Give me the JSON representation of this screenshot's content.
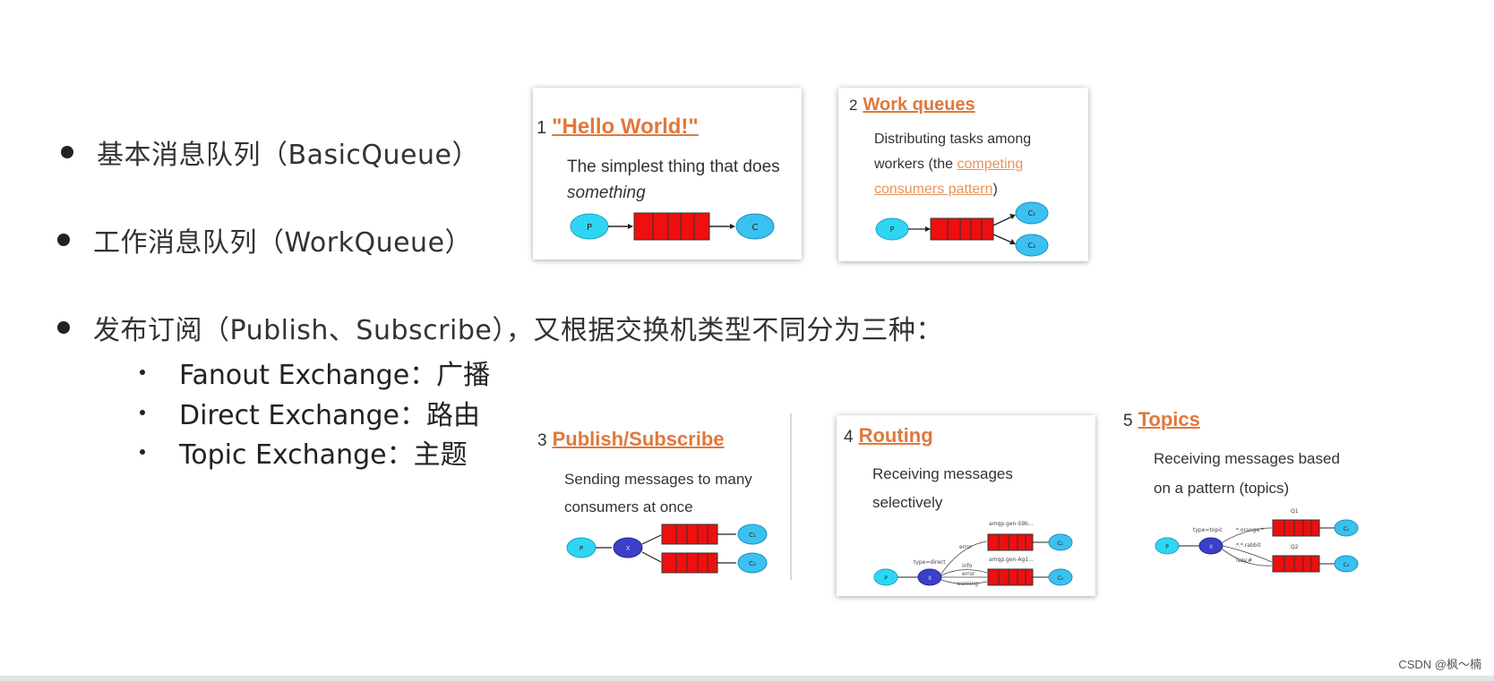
{
  "bullets": {
    "basic": "基本消息队列（BasicQueue）",
    "work": "工作消息队列（WorkQueue）",
    "pubsub": "发布订阅（Publish、Subscribe），又根据交换机类型不同分为三种：",
    "sub_items": [
      "Fanout Exchange：广播",
      "Direct Exchange：路由",
      "Topic Exchange：主题"
    ]
  },
  "cards": {
    "hello": {
      "num": "1",
      "title": "\"Hello World!\"",
      "desc_line1": "The simplest thing that does",
      "desc_line2": "something",
      "node_p": "P",
      "node_c": "C"
    },
    "work": {
      "num": "2",
      "title": "Work queues",
      "desc_line1": "Distributing tasks among",
      "desc_line2_prefix": "workers (the ",
      "desc_link_line2": "competing",
      "desc_link_line3": "consumers pattern",
      "desc_line3_suffix": ")",
      "node_p": "P",
      "node_c1": "C₁",
      "node_c2": "C₂"
    },
    "pubsub": {
      "num": "3",
      "title": "Publish/Subscribe",
      "desc_line1": "Sending messages to many",
      "desc_line2": "consumers at once",
      "node_p": "P",
      "node_x": "X",
      "node_c1": "C₁",
      "node_c2": "C₂"
    },
    "routing": {
      "num": "4",
      "title": "Routing",
      "desc_line1": "Receiving messages",
      "desc_line2": "selectively",
      "node_p": "P",
      "node_x": "X",
      "node_c1": "C₁",
      "node_c2": "C₂",
      "exchange_type": "type=direct",
      "queue1_name": "amqp.gen-S9b...",
      "queue2_name": "amqp.gen-Ag1...",
      "key_error": "error",
      "key_info": "info",
      "key_error2": "error",
      "key_warning": "warning"
    },
    "topics": {
      "num": "5",
      "title": "Topics",
      "desc_line1": "Receiving messages based",
      "desc_line2": "on a pattern (topics)",
      "node_p": "P",
      "node_x": "X",
      "node_c1": "C₁",
      "node_c2": "C₂",
      "exchange_type": "type=topic",
      "queue1_name": "Q1",
      "queue2_name": "Q2",
      "key1": "*.orange.*",
      "key2": "*.*.rabbit",
      "key3": "lazy.#"
    }
  },
  "watermark": "CSDN @枫～楠",
  "colors": {
    "accent": "#e0783b",
    "queue_red": "#ee0f0f",
    "producer_cyan": "#2fd6f3",
    "consumer_blue": "#3bc1ef",
    "exchange_indigo": "#3b3fc9"
  }
}
